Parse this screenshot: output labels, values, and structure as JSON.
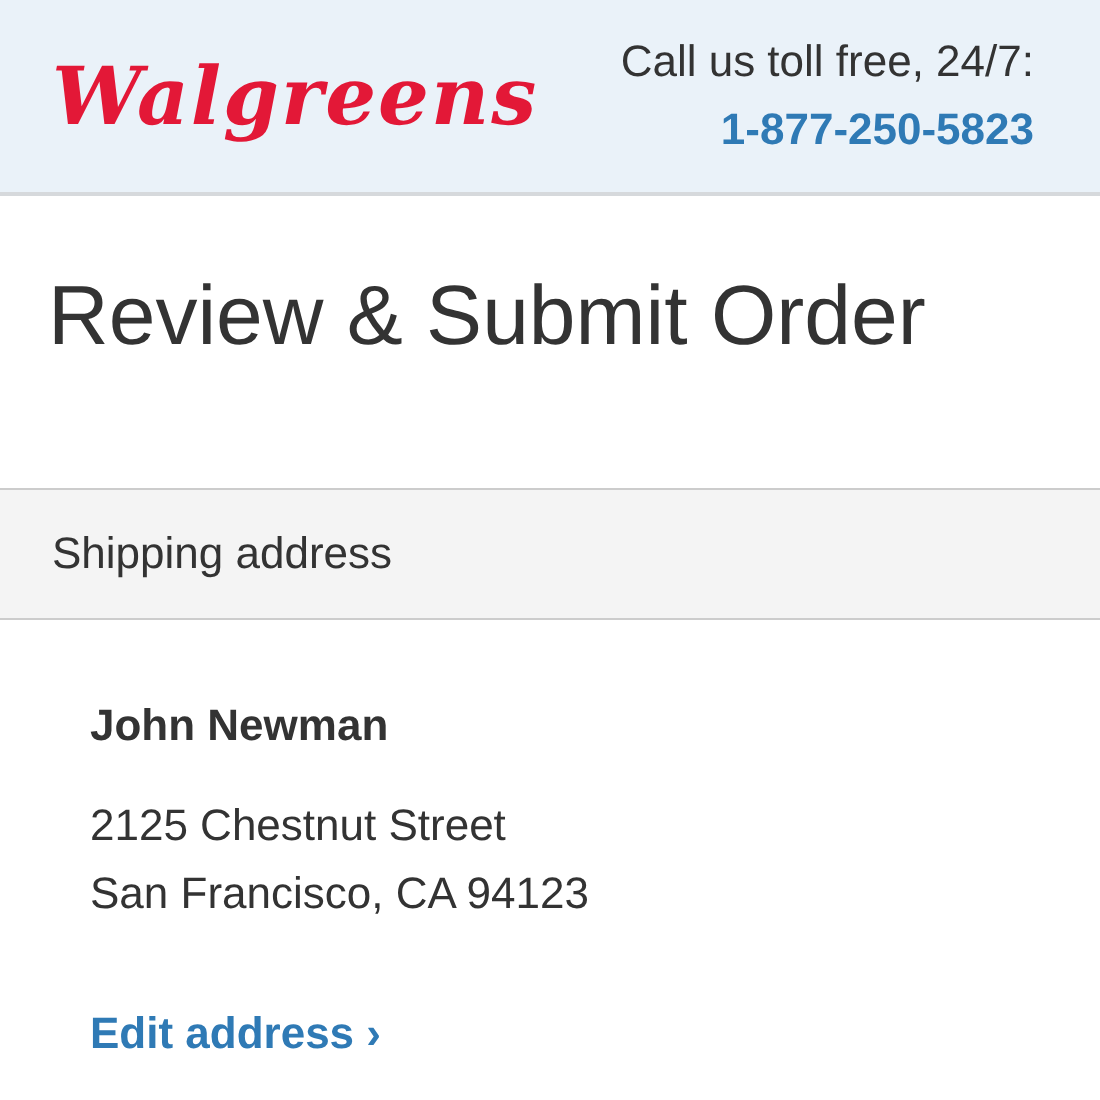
{
  "header": {
    "logo": "Walgreens",
    "call_label": "Call us toll free, 24/7:",
    "phone": "1-877-250-5823"
  },
  "title": "Review & Submit Order",
  "section": {
    "heading": "Shipping address",
    "name": "John Newman",
    "address_lines": [
      "2125 Chestnut Street",
      "San Francisco, CA 94123"
    ],
    "edit_link": "Edit address ›"
  }
}
